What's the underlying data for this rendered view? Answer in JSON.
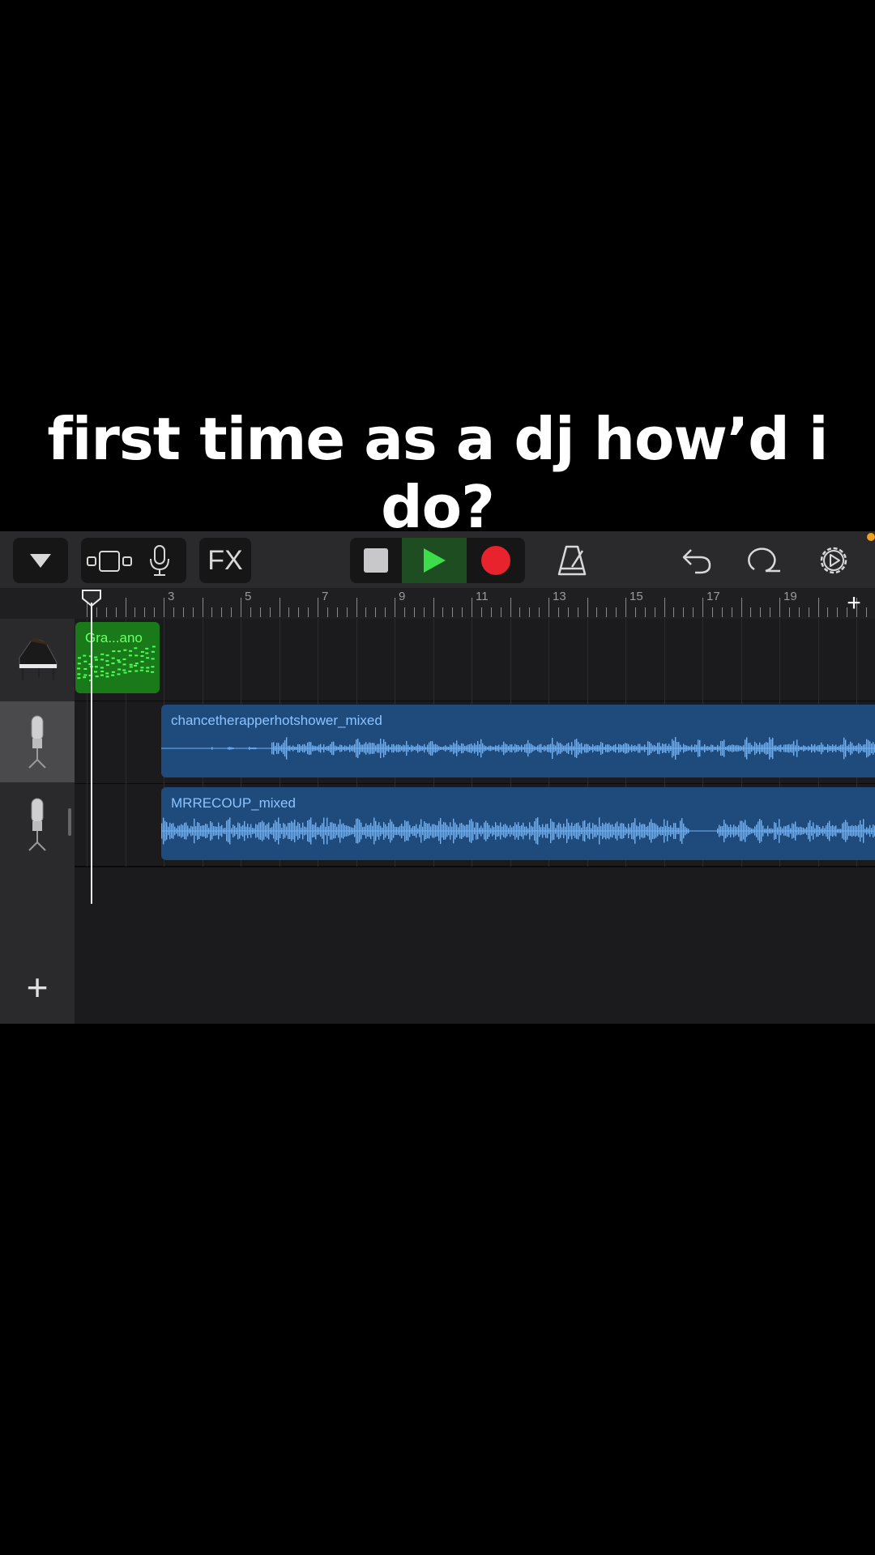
{
  "caption": "first time as a dj how’d i do?",
  "toolbar": {
    "fx_label": "FX"
  },
  "ruler": {
    "bar_numbers": [
      "3",
      "5",
      "7",
      "9",
      "11",
      "13",
      "15",
      "17",
      "19"
    ]
  },
  "tracks": [
    {
      "instrument": "grand-piano",
      "region_name": "Gra...ano",
      "region_type": "midi"
    },
    {
      "instrument": "microphone",
      "region_name": "chancetherapperhotshower_mixed",
      "region_type": "audio"
    },
    {
      "instrument": "microphone",
      "region_name": "MRRECOUP_mixed",
      "region_type": "audio"
    }
  ],
  "colors": {
    "record": "#e8232e",
    "play": "#3ddc4a",
    "audio_region": "#1e4a7c",
    "midi_region": "#1a7a1a",
    "waveform": "#6ab4ff"
  }
}
